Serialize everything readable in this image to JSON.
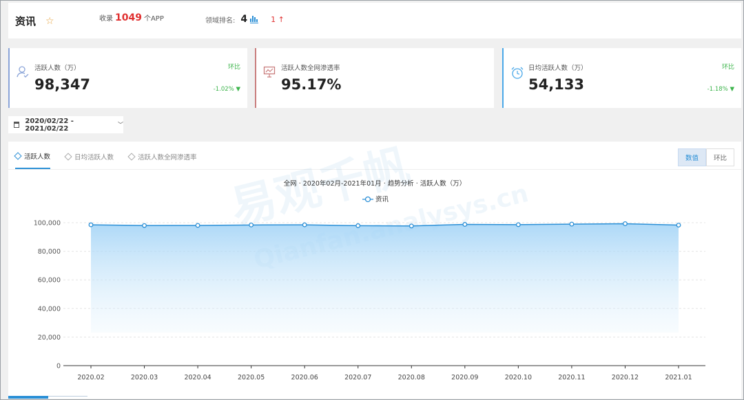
{
  "header": {
    "title": "资讯",
    "included_prefix": "收录",
    "included_count": "1049",
    "included_suffix": "个APP",
    "rank_label": "领域排名:",
    "rank_value": "4",
    "rank_change": "1 ↑"
  },
  "cards": [
    {
      "label": "活跃人数（万）",
      "value": "98,347",
      "compare_label": "环比",
      "change": "-1.02%",
      "change_dir": "down"
    },
    {
      "label": "活跃人数全网渗透率",
      "value": "95.17%"
    },
    {
      "label": "日均活跃人数（万）",
      "value": "54,133",
      "compare_label": "环比",
      "change": "-1.18%",
      "change_dir": "down"
    }
  ],
  "date_range": "2020/02/22 - 2021/02/22",
  "tabs": [
    "活跃人数",
    "日均活跃人数",
    "活跃人数全网渗透率"
  ],
  "active_tab": 0,
  "view_toggle": [
    "数值",
    "环比"
  ],
  "active_view": 0,
  "watermark": [
    "易观千帆",
    "Qianfan.analysys.cn"
  ],
  "colors": {
    "accent": "#2a8fd6",
    "down": "#3cb44b",
    "up": "#e03030"
  },
  "chart_data": {
    "type": "area",
    "title": "全网 · 2020年02月-2021年01月 · 趋势分析 · 活跃人数（万）",
    "categories": [
      "2020.02",
      "2020.03",
      "2020.04",
      "2020.05",
      "2020.06",
      "2020.07",
      "2020.08",
      "2020.09",
      "2020.10",
      "2020.11",
      "2020.12",
      "2021.01"
    ],
    "series": [
      {
        "name": "资讯",
        "values": [
          98500,
          98000,
          98100,
          98400,
          98500,
          97900,
          97700,
          98800,
          98600,
          99000,
          99300,
          98300
        ]
      }
    ],
    "ylim": [
      0,
      100000
    ],
    "yticks": [
      0,
      20000,
      40000,
      60000,
      80000,
      100000
    ],
    "ytick_labels": [
      "0",
      "20,000",
      "40,000",
      "60,000",
      "80,000",
      "100,000"
    ],
    "grid": true,
    "legend": "top-center"
  }
}
